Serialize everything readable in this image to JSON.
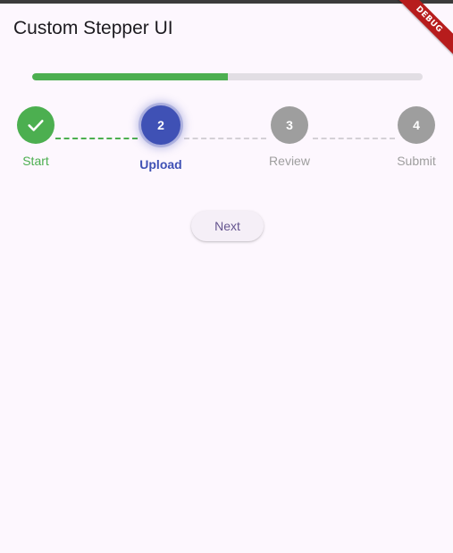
{
  "app": {
    "title": "Custom Stepper UI",
    "debug_banner": "DEBUG"
  },
  "progress": {
    "value": 0.5,
    "color": "#4caf50",
    "track_color": "#e2dee4"
  },
  "stepper": {
    "current_step": 2,
    "steps": [
      {
        "number": "",
        "label": "Start",
        "state": "done",
        "icon": "check-icon"
      },
      {
        "number": "2",
        "label": "Upload",
        "state": "active"
      },
      {
        "number": "3",
        "label": "Review",
        "state": "pending"
      },
      {
        "number": "4",
        "label": "Submit",
        "state": "pending"
      }
    ],
    "colors": {
      "done": "#4caf50",
      "active": "#3f51b5",
      "pending": "#9e9e9e"
    }
  },
  "actions": {
    "next_label": "Next"
  }
}
